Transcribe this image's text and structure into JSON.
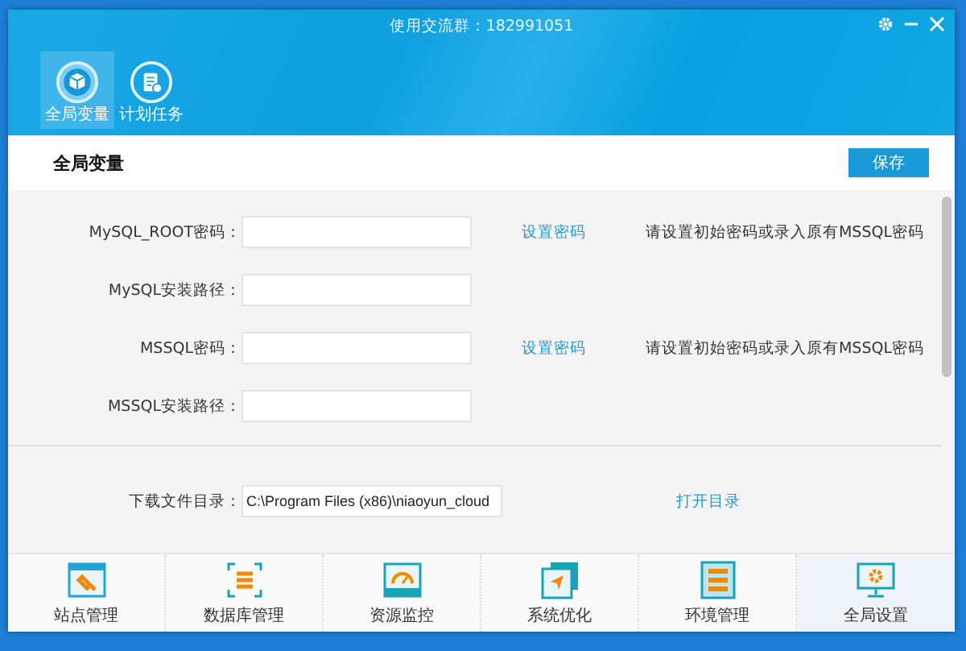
{
  "window": {
    "title": "使用交流群：182991051"
  },
  "tabs": [
    {
      "label": "全局变量",
      "selected": true
    },
    {
      "label": "计划任务",
      "selected": false
    }
  ],
  "section": {
    "title": "全局变量",
    "save_button": "保存"
  },
  "fields": [
    {
      "label": "MySQL_ROOT密码：",
      "link": "设置密码",
      "hint": "请设置初始密码或录入原有MSSQL密码"
    },
    {
      "label": "MySQL安装路径："
    },
    {
      "label": "MSSQL密码：",
      "link": "设置密码",
      "hint": "请设置初始密码或录入原有MSSQL密码"
    },
    {
      "label": "MSSQL安装路径："
    }
  ],
  "download": {
    "label": "下载文件目录：",
    "value": "C:\\Program Files (x86)\\niaoyun_cloud",
    "link": "打开目录"
  },
  "nav": [
    {
      "label": "站点管理",
      "selected": false
    },
    {
      "label": "数据库管理",
      "selected": false
    },
    {
      "label": "资源监控",
      "selected": false
    },
    {
      "label": "系统优化",
      "selected": false
    },
    {
      "label": "环境管理",
      "selected": false
    },
    {
      "label": "全局设置",
      "selected": true
    }
  ]
}
